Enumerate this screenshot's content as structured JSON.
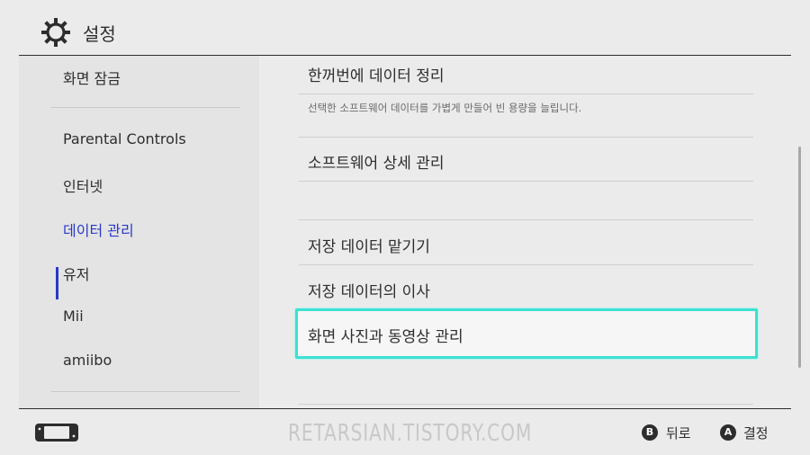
{
  "header": {
    "title": "설정"
  },
  "sidebar": {
    "items": [
      {
        "label": "화면 잠금"
      },
      {
        "label": "Parental Controls"
      },
      {
        "label": "인터넷"
      },
      {
        "label": "데이터 관리",
        "selected": true
      },
      {
        "label": "유저"
      },
      {
        "label": "Mii"
      },
      {
        "label": "amiibo"
      }
    ]
  },
  "main": {
    "rows": [
      {
        "label": "한꺼번에 데이터 정리",
        "description": "선택한 소프트웨어 데이터를 가볍게 만들어 빈 용량을 늘립니다."
      },
      {
        "label": "소프트웨어 상세 관리"
      },
      {
        "label": "저장 데이터 맡기기"
      },
      {
        "label": "저장 데이터의 이사"
      },
      {
        "label": "화면 사진과 동영상 관리",
        "focused": true
      }
    ]
  },
  "footer": {
    "watermark": "RETARSIAN.TISTORY.COM",
    "back": {
      "button": "B",
      "label": "뒤로"
    },
    "confirm": {
      "button": "A",
      "label": "결정"
    }
  },
  "colors": {
    "background": "#ebebeb",
    "sidebar_bg": "#e4e4e4",
    "selected": "#2a38c8",
    "focus_border": "#3fe0d0"
  }
}
